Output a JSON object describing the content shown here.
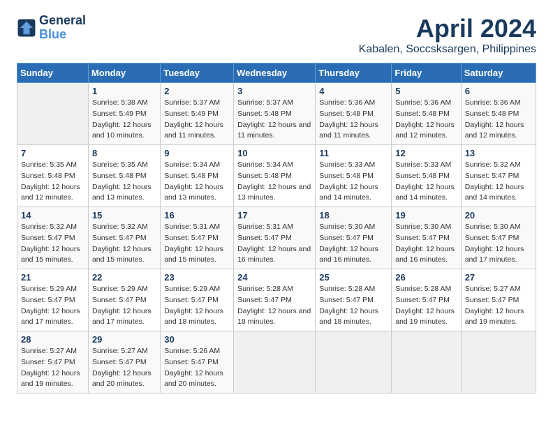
{
  "header": {
    "logo_line1": "General",
    "logo_line2": "Blue",
    "month_title": "April 2024",
    "location": "Kabalen, Soccsksargen, Philippines"
  },
  "weekdays": [
    "Sunday",
    "Monday",
    "Tuesday",
    "Wednesday",
    "Thursday",
    "Friday",
    "Saturday"
  ],
  "weeks": [
    [
      {
        "day": "",
        "empty": true
      },
      {
        "day": "1",
        "sunrise": "5:38 AM",
        "sunset": "5:49 PM",
        "daylight": "12 hours and 10 minutes."
      },
      {
        "day": "2",
        "sunrise": "5:37 AM",
        "sunset": "5:49 PM",
        "daylight": "12 hours and 11 minutes."
      },
      {
        "day": "3",
        "sunrise": "5:37 AM",
        "sunset": "5:48 PM",
        "daylight": "12 hours and 11 minutes."
      },
      {
        "day": "4",
        "sunrise": "5:36 AM",
        "sunset": "5:48 PM",
        "daylight": "12 hours and 11 minutes."
      },
      {
        "day": "5",
        "sunrise": "5:36 AM",
        "sunset": "5:48 PM",
        "daylight": "12 hours and 12 minutes."
      },
      {
        "day": "6",
        "sunrise": "5:36 AM",
        "sunset": "5:48 PM",
        "daylight": "12 hours and 12 minutes."
      }
    ],
    [
      {
        "day": "7",
        "sunrise": "5:35 AM",
        "sunset": "5:48 PM",
        "daylight": "12 hours and 12 minutes."
      },
      {
        "day": "8",
        "sunrise": "5:35 AM",
        "sunset": "5:48 PM",
        "daylight": "12 hours and 13 minutes."
      },
      {
        "day": "9",
        "sunrise": "5:34 AM",
        "sunset": "5:48 PM",
        "daylight": "12 hours and 13 minutes."
      },
      {
        "day": "10",
        "sunrise": "5:34 AM",
        "sunset": "5:48 PM",
        "daylight": "12 hours and 13 minutes."
      },
      {
        "day": "11",
        "sunrise": "5:33 AM",
        "sunset": "5:48 PM",
        "daylight": "12 hours and 14 minutes."
      },
      {
        "day": "12",
        "sunrise": "5:33 AM",
        "sunset": "5:48 PM",
        "daylight": "12 hours and 14 minutes."
      },
      {
        "day": "13",
        "sunrise": "5:32 AM",
        "sunset": "5:47 PM",
        "daylight": "12 hours and 14 minutes."
      }
    ],
    [
      {
        "day": "14",
        "sunrise": "5:32 AM",
        "sunset": "5:47 PM",
        "daylight": "12 hours and 15 minutes."
      },
      {
        "day": "15",
        "sunrise": "5:32 AM",
        "sunset": "5:47 PM",
        "daylight": "12 hours and 15 minutes."
      },
      {
        "day": "16",
        "sunrise": "5:31 AM",
        "sunset": "5:47 PM",
        "daylight": "12 hours and 15 minutes."
      },
      {
        "day": "17",
        "sunrise": "5:31 AM",
        "sunset": "5:47 PM",
        "daylight": "12 hours and 16 minutes."
      },
      {
        "day": "18",
        "sunrise": "5:30 AM",
        "sunset": "5:47 PM",
        "daylight": "12 hours and 16 minutes."
      },
      {
        "day": "19",
        "sunrise": "5:30 AM",
        "sunset": "5:47 PM",
        "daylight": "12 hours and 16 minutes."
      },
      {
        "day": "20",
        "sunrise": "5:30 AM",
        "sunset": "5:47 PM",
        "daylight": "12 hours and 17 minutes."
      }
    ],
    [
      {
        "day": "21",
        "sunrise": "5:29 AM",
        "sunset": "5:47 PM",
        "daylight": "12 hours and 17 minutes."
      },
      {
        "day": "22",
        "sunrise": "5:29 AM",
        "sunset": "5:47 PM",
        "daylight": "12 hours and 17 minutes."
      },
      {
        "day": "23",
        "sunrise": "5:29 AM",
        "sunset": "5:47 PM",
        "daylight": "12 hours and 18 minutes."
      },
      {
        "day": "24",
        "sunrise": "5:28 AM",
        "sunset": "5:47 PM",
        "daylight": "12 hours and 18 minutes."
      },
      {
        "day": "25",
        "sunrise": "5:28 AM",
        "sunset": "5:47 PM",
        "daylight": "12 hours and 18 minutes."
      },
      {
        "day": "26",
        "sunrise": "5:28 AM",
        "sunset": "5:47 PM",
        "daylight": "12 hours and 19 minutes."
      },
      {
        "day": "27",
        "sunrise": "5:27 AM",
        "sunset": "5:47 PM",
        "daylight": "12 hours and 19 minutes."
      }
    ],
    [
      {
        "day": "28",
        "sunrise": "5:27 AM",
        "sunset": "5:47 PM",
        "daylight": "12 hours and 19 minutes."
      },
      {
        "day": "29",
        "sunrise": "5:27 AM",
        "sunset": "5:47 PM",
        "daylight": "12 hours and 20 minutes."
      },
      {
        "day": "30",
        "sunrise": "5:26 AM",
        "sunset": "5:47 PM",
        "daylight": "12 hours and 20 minutes."
      },
      {
        "day": "",
        "empty": true
      },
      {
        "day": "",
        "empty": true
      },
      {
        "day": "",
        "empty": true
      },
      {
        "day": "",
        "empty": true
      }
    ]
  ]
}
